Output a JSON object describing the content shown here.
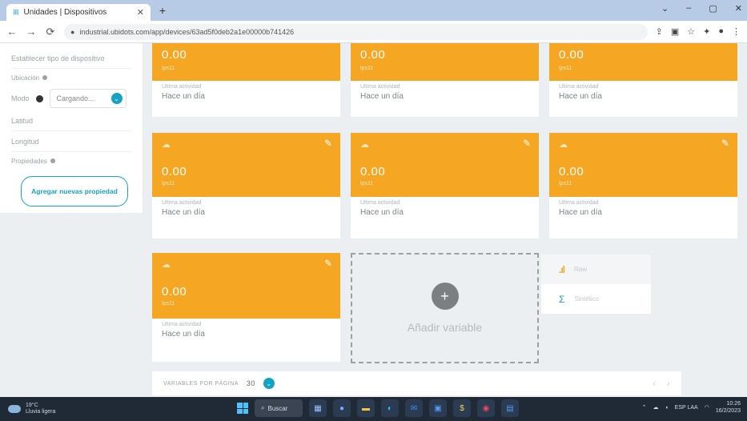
{
  "browser": {
    "tab_title": "Unidades | Dispositivos",
    "url": "industrial.ubidots.com/app/devices/63ad5f0deb2a1e00000b741426",
    "window_controls": [
      "⌄",
      "–",
      "▢",
      "✕"
    ]
  },
  "left_panel": {
    "type_placeholder": "Establecer tipo de dispositivo",
    "ubicacion_label": "Ubicación",
    "modo_label": "Modo",
    "modo_value": "Cargando...",
    "latitud_label": "Latitud",
    "longitud_label": "Longitud",
    "propiedades_label": "Propiedades",
    "add_property_button": "Agregar nuevas propiedad"
  },
  "cards": [
    {
      "value": "0.00",
      "unit": "lps11",
      "meta": "Última actividad",
      "time": "Hace un día"
    },
    {
      "value": "0.00",
      "unit": "lps11",
      "meta": "Última actividad",
      "time": "Hace un día"
    },
    {
      "value": "0.00",
      "unit": "lps11",
      "meta": "Última actividad",
      "time": "Hace un día"
    },
    {
      "value": "0.00",
      "unit": "lps11",
      "meta": "Última actividad",
      "time": "Hace un día"
    },
    {
      "value": "0.00",
      "unit": "lps11",
      "meta": "Última actividad",
      "time": "Hace un día"
    },
    {
      "value": "0.00",
      "unit": "lps11",
      "meta": "Última actividad",
      "time": "Hace un día"
    },
    {
      "value": "0.00",
      "unit": "lps11",
      "meta": "Última actividad",
      "time": "Hace un día"
    }
  ],
  "add_variable": {
    "label": "Añadir variable",
    "icon": "+"
  },
  "widget_menu": {
    "items": [
      {
        "label": "Raw",
        "icon": "bars-icon"
      },
      {
        "label": "Sintético",
        "icon": "sigma-icon"
      }
    ]
  },
  "pagination": {
    "label": "VARIABLES POR PÁGINA",
    "value": "30",
    "prev": "‹",
    "next": "›"
  },
  "taskbar": {
    "weather_temp": "19°C",
    "weather_desc": "Lluvia ligera",
    "search_label": "Buscar",
    "lang": "ESP LAA",
    "time": "10:26",
    "date": "16/2/2023"
  },
  "colors": {
    "card_accent": "#f5a623",
    "brand_blue": "#16a3c2",
    "page_bg": "#eceff1"
  }
}
